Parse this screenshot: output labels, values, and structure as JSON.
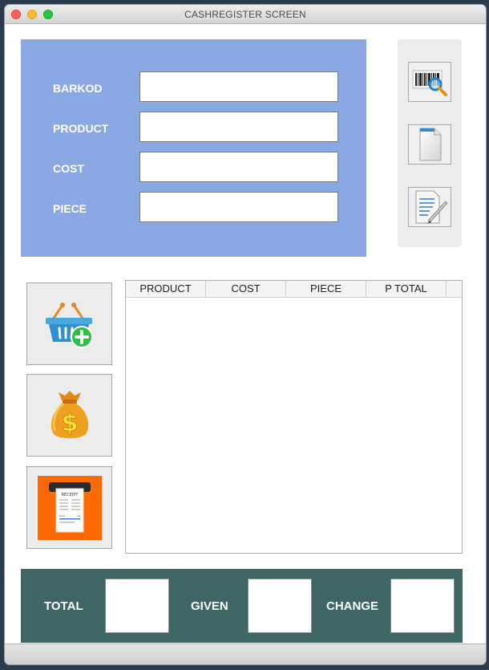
{
  "window": {
    "title": "CASHREGISTER SCREEN"
  },
  "form": {
    "barkod_label": "BARKOD",
    "product_label": "PRODUCT",
    "cost_label": "COST",
    "piece_label": "PIECE",
    "barkod_value": "",
    "product_value": "",
    "cost_value": "",
    "piece_value": ""
  },
  "side_buttons": [
    {
      "icon": "barcode-search-icon"
    },
    {
      "icon": "blank-document-icon"
    },
    {
      "icon": "document-edit-icon"
    }
  ],
  "action_buttons": [
    {
      "icon": "basket-add-icon"
    },
    {
      "icon": "money-bag-icon"
    },
    {
      "icon": "receipt-printer-icon",
      "receipt_text": "RECEIPT"
    }
  ],
  "table": {
    "columns": [
      "PRODUCT",
      "COST",
      "PIECE",
      "P TOTAL"
    ],
    "rows": []
  },
  "totals": {
    "total_label": "TOTAL",
    "given_label": "GIVEN",
    "change_label": "CHANGE",
    "total_value": "",
    "given_value": "",
    "change_value": ""
  },
  "colors": {
    "form_panel": "#8aa8e4",
    "totals_panel": "#3d6665",
    "printer_bg": "#ff6a00"
  }
}
